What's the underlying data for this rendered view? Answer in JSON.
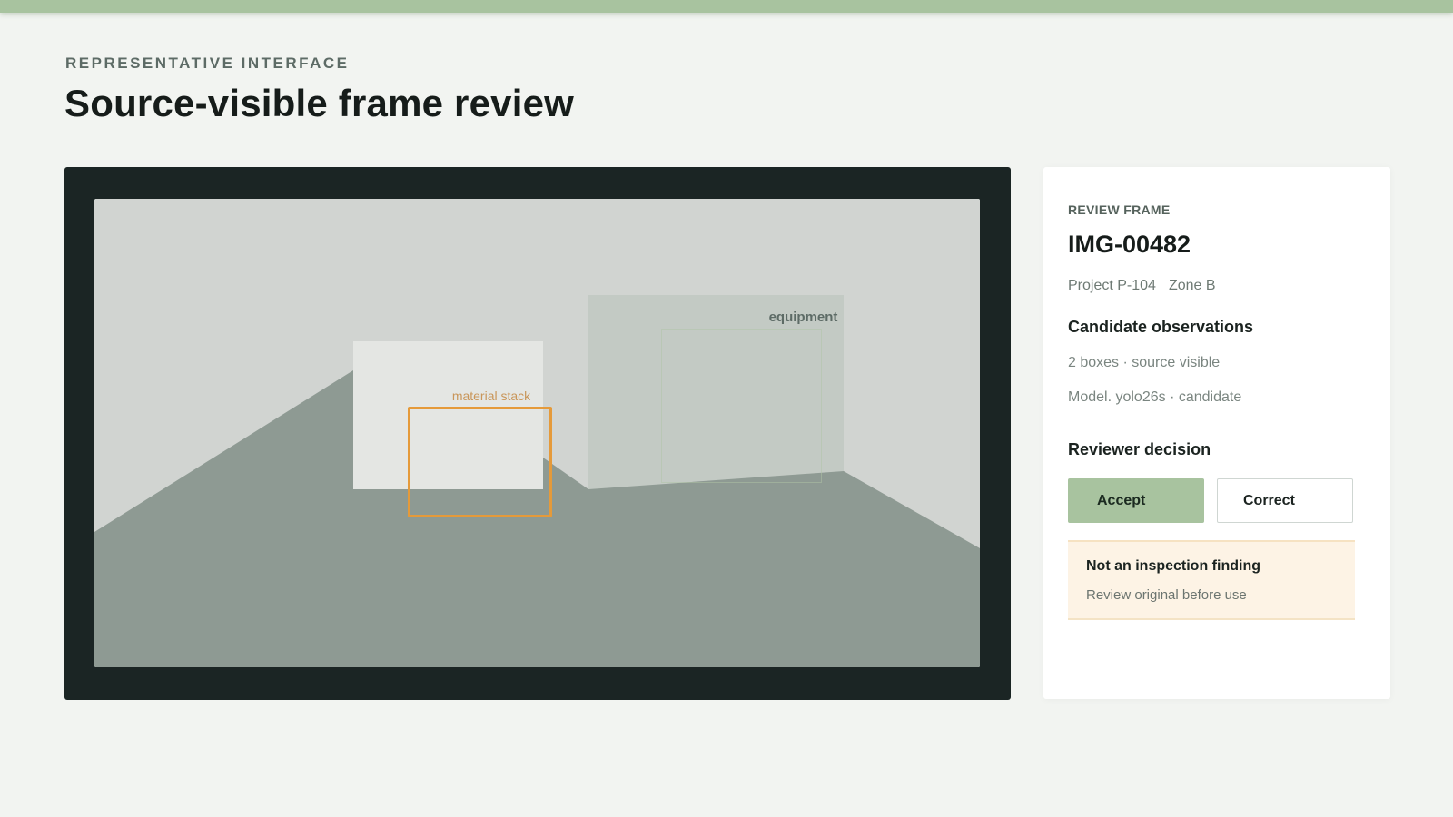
{
  "header": {
    "eyebrow": "REPRESENTATIVE INTERFACE",
    "title": "Source-visible frame review"
  },
  "viewer": {
    "objects": [
      {
        "label": "equipment",
        "color": "#5d6b66"
      },
      {
        "label": "material stack",
        "color": "#e59a3a"
      }
    ]
  },
  "panel": {
    "eyebrow": "REVIEW FRAME",
    "frame_id": "IMG-00482",
    "project": "Project P-104",
    "zone": "Zone B",
    "observations_heading": "Candidate observations",
    "observation_summary": "2 boxes · source visible",
    "model_line": "Model. yolo26s · candidate",
    "decision_heading": "Reviewer decision",
    "accept_label": "Accept",
    "correct_label": "Correct",
    "notice": {
      "title": "Not an inspection finding",
      "text": "Review original before use"
    }
  },
  "colors": {
    "accent": "#a8c39f",
    "viewer_bg": "#1b2524",
    "bbox_candidate": "#e59a3a",
    "notice_bg": "#fdf3e5"
  }
}
